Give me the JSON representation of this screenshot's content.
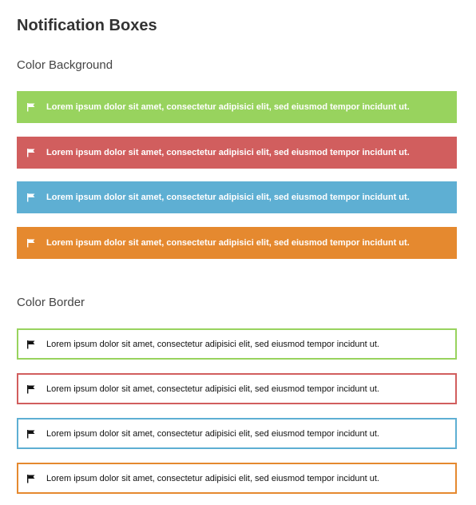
{
  "page": {
    "title": "Notification Boxes"
  },
  "sections": {
    "background": {
      "title": "Color Background",
      "boxes": [
        {
          "icon": "flag-icon",
          "color": "#98d35e",
          "text": "Lorem ipsum dolor sit amet, consectetur adipisici elit, sed eiusmod tempor incidunt ut."
        },
        {
          "icon": "flag-icon",
          "color": "#d15e5e",
          "text": "Lorem ipsum dolor sit amet, consectetur adipisici elit, sed eiusmod tempor incidunt ut."
        },
        {
          "icon": "flag-icon",
          "color": "#5eafd3",
          "text": "Lorem ipsum dolor sit amet, consectetur adipisici elit, sed eiusmod tempor incidunt ut."
        },
        {
          "icon": "flag-icon",
          "color": "#e5892f",
          "text": "Lorem ipsum dolor sit amet, consectetur adipisici elit, sed eiusmod tempor incidunt ut."
        }
      ]
    },
    "border": {
      "title": "Color Border",
      "boxes": [
        {
          "icon": "flag-icon",
          "color": "#98d35e",
          "text": "Lorem ipsum dolor sit amet, consectetur adipisici elit, sed eiusmod tempor incidunt ut."
        },
        {
          "icon": "flag-icon",
          "color": "#d15e5e",
          "text": "Lorem ipsum dolor sit amet, consectetur adipisici elit, sed eiusmod tempor incidunt ut."
        },
        {
          "icon": "flag-icon",
          "color": "#5eafd3",
          "text": "Lorem ipsum dolor sit amet, consectetur adipisici elit, sed eiusmod tempor incidunt ut."
        },
        {
          "icon": "flag-icon",
          "color": "#e5892f",
          "text": "Lorem ipsum dolor sit amet, consectetur adipisici elit, sed eiusmod tempor incidunt ut."
        }
      ]
    }
  }
}
